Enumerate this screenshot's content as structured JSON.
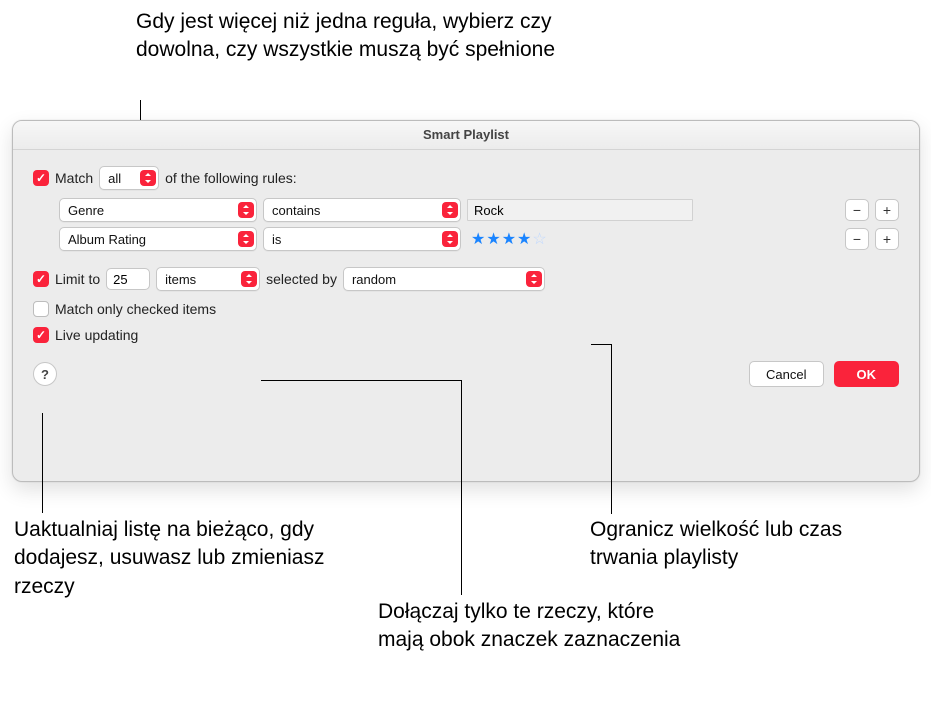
{
  "window": {
    "title": "Smart Playlist"
  },
  "match": {
    "label_before": "Match",
    "mode": "all",
    "label_after": "of the following rules:"
  },
  "rules": [
    {
      "attribute": "Genre",
      "operator": "contains",
      "value_type": "text",
      "value": "Rock"
    },
    {
      "attribute": "Album Rating",
      "operator": "is",
      "value_type": "rating",
      "value": 4,
      "out_of": 5
    }
  ],
  "limit": {
    "label": "Limit to",
    "count": "25",
    "unit": "items",
    "selected_by_label": "selected by",
    "selected_by": "random"
  },
  "match_checked": {
    "label": "Match only checked items",
    "checked": false
  },
  "live_updating": {
    "label": "Live updating",
    "checked": true
  },
  "buttons": {
    "cancel": "Cancel",
    "ok": "OK"
  },
  "callouts": {
    "top": "Gdy jest więcej niż jedna reguła, wybierz czy dowolna, czy wszystkie muszą być spełnione",
    "live": "Uaktualniaj listę na bieżąco, gdy dodajesz, usuwasz lub zmieniasz rzeczy",
    "limit": "Ogranicz wielkość lub czas trwania playlisty",
    "checked": "Dołączaj tylko te rzeczy, które mają obok znaczek zaznaczenia"
  }
}
